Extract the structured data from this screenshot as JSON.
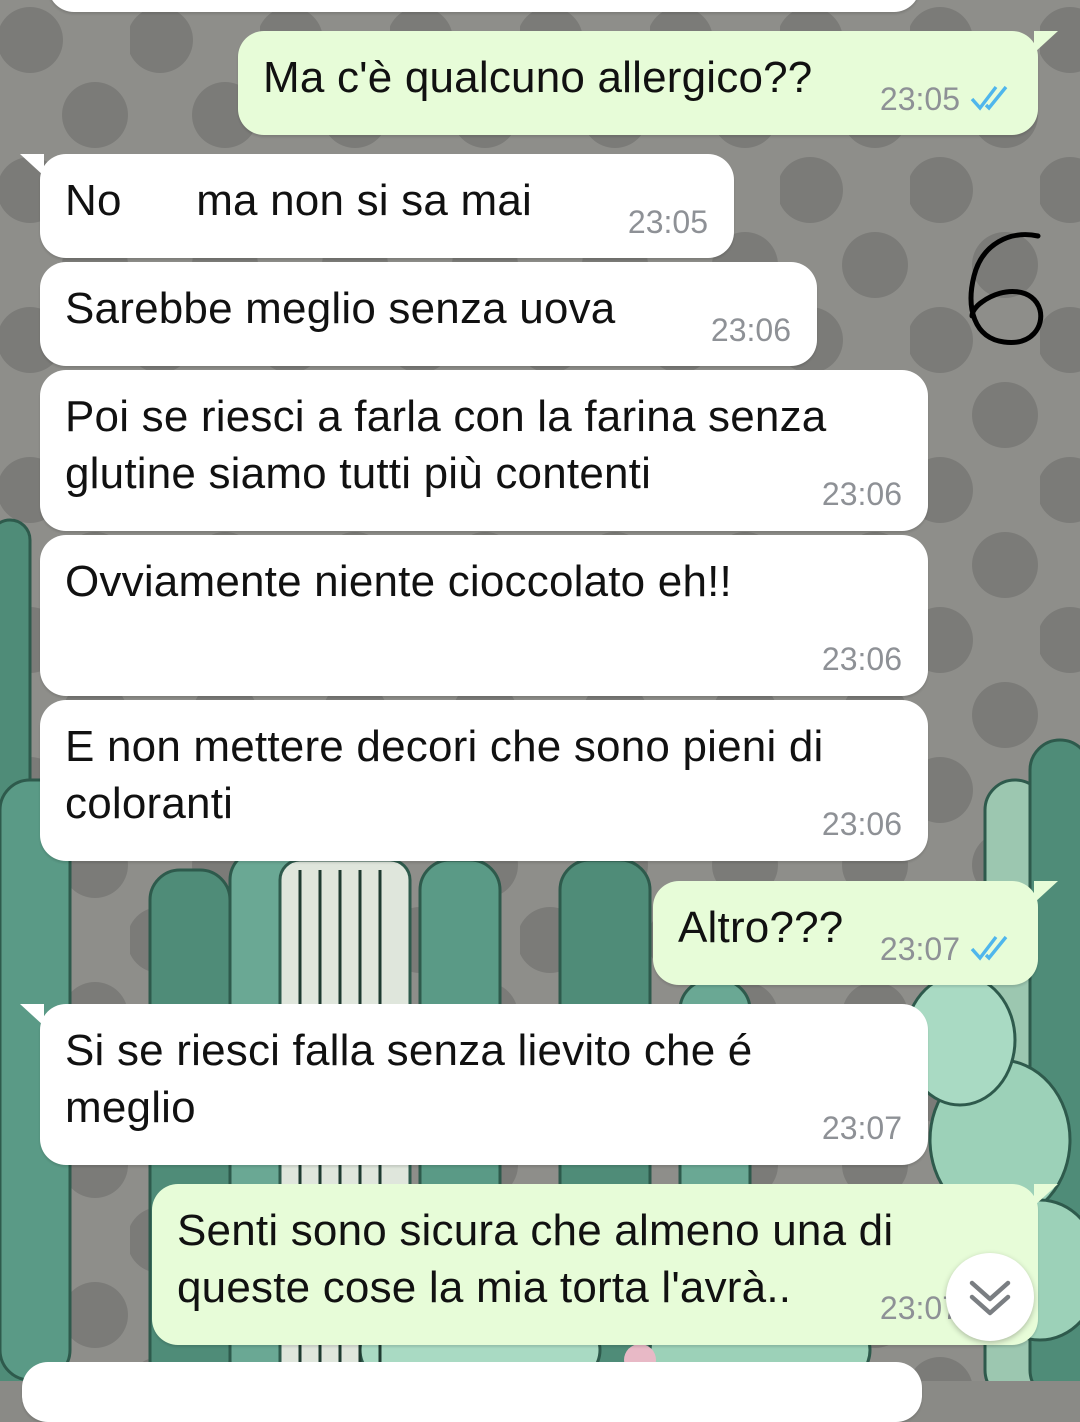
{
  "messages": [
    {
      "dir": "out",
      "text": "Ma c'è qualcuno allergico??",
      "time": "23:05",
      "status": "read"
    },
    {
      "dir": "in",
      "text": "No      ma non si sa mai",
      "time": "23:05"
    },
    {
      "dir": "in",
      "text": "Sarebbe meglio senza uova",
      "time": "23:06"
    },
    {
      "dir": "in",
      "text": "Poi se riesci a farla con la farina senza\nglutine siamo tutti più contenti",
      "time": "23:06"
    },
    {
      "dir": "in",
      "text": "Ovviamente niente cioccolato eh!!",
      "time": "23:06"
    },
    {
      "dir": "in",
      "text": "E non mettere decori che sono pieni di\ncoloranti",
      "time": "23:06"
    },
    {
      "dir": "out",
      "text": "Altro???",
      "time": "23:07",
      "status": "read"
    },
    {
      "dir": "in",
      "text": "Si se riesci falla senza lievito che é\nmeglio",
      "time": "23:07"
    },
    {
      "dir": "out",
      "text": "Senti sono sicura che almeno una di\nqueste cose la mia torta l'avrà..",
      "time": "23:07",
      "status": "read"
    }
  ],
  "annotation": "6",
  "icons": {
    "read_ticks": "double-check-icon",
    "scroll": "chevron-double-down-icon"
  },
  "colors": {
    "incoming": "#ffffff",
    "outgoing": "#e7fcd8",
    "read_tick": "#4fb6ec",
    "time": "#8e9196"
  }
}
